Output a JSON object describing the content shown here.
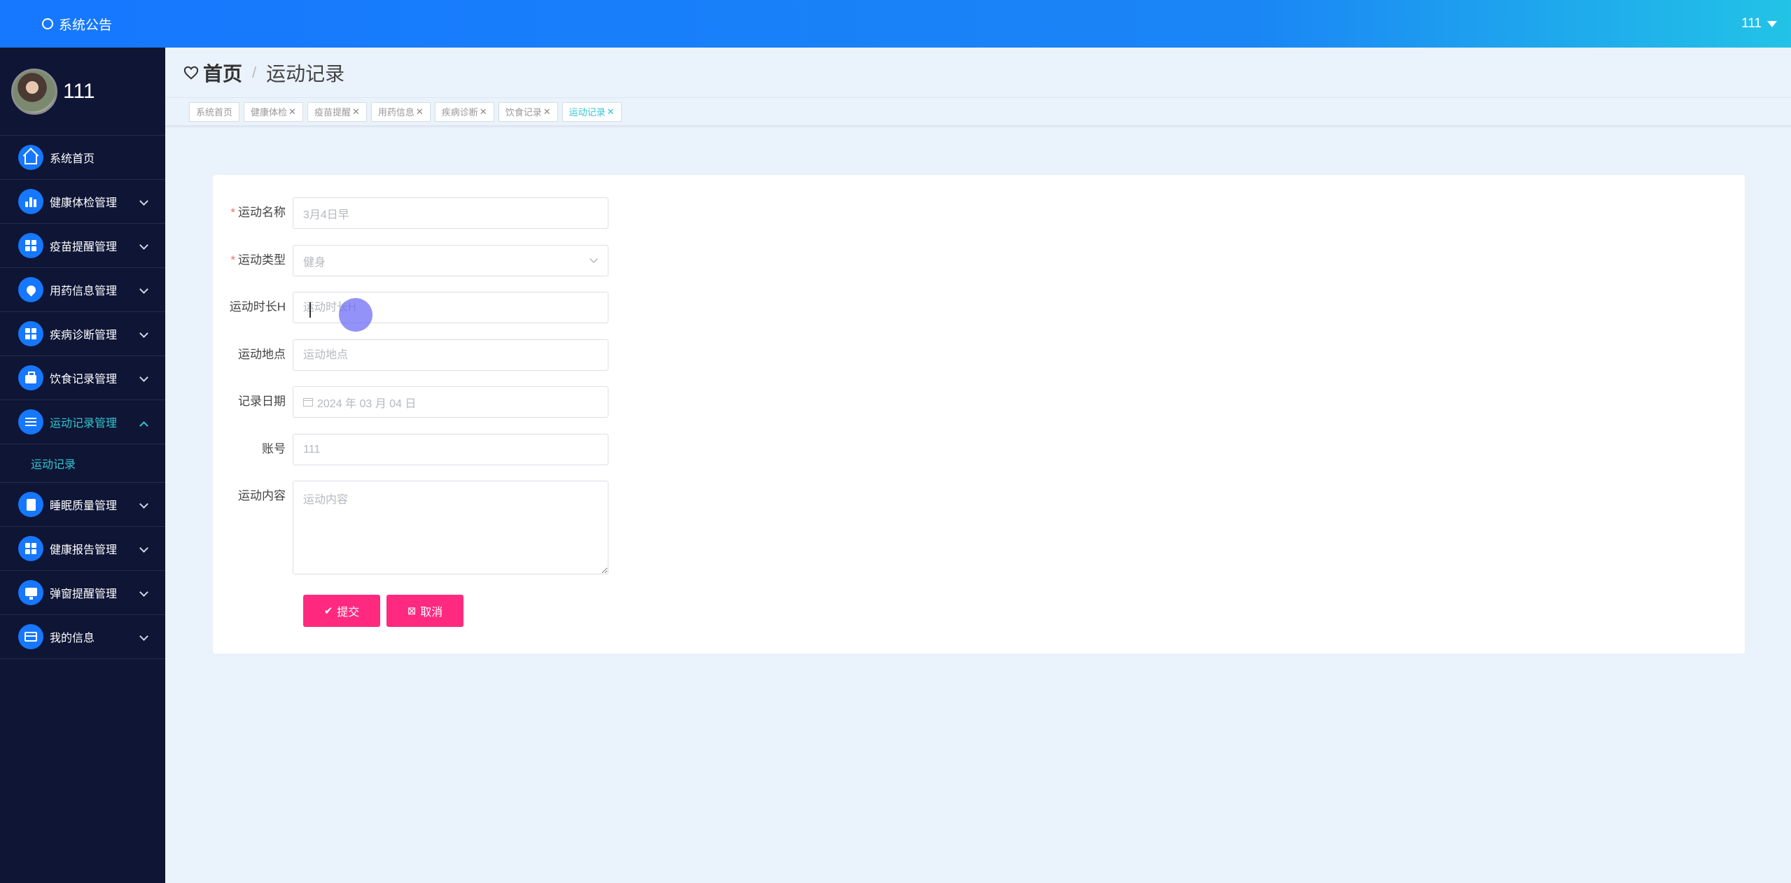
{
  "topbar": {
    "notice_label": "系统公告",
    "user_label": "111"
  },
  "profile": {
    "name": "111"
  },
  "sidebar": {
    "items": [
      {
        "label": "系统首页",
        "icon": "home-icon"
      },
      {
        "label": "健康体检管理",
        "icon": "bar-chart-icon"
      },
      {
        "label": "疫苗提醒管理",
        "icon": "grid-icon"
      },
      {
        "label": "用药信息管理",
        "icon": "location-icon"
      },
      {
        "label": "疾病诊断管理",
        "icon": "grid-icon"
      },
      {
        "label": "饮食记录管理",
        "icon": "briefcase-icon"
      },
      {
        "label": "运动记录管理",
        "icon": "list-icon"
      },
      {
        "label": "睡眠质量管理",
        "icon": "clipboard-icon"
      },
      {
        "label": "健康报告管理",
        "icon": "grid-icon"
      },
      {
        "label": "弹窗提醒管理",
        "icon": "monitor-icon"
      },
      {
        "label": "我的信息",
        "icon": "card-icon"
      }
    ],
    "submenu_label": "运动记录"
  },
  "breadcrumb": {
    "home": "首页",
    "separator": "/",
    "current": "运动记录"
  },
  "tabs": [
    {
      "label": "系统首页",
      "closable": false
    },
    {
      "label": "健康体检",
      "closable": true
    },
    {
      "label": "疫苗提醒",
      "closable": true
    },
    {
      "label": "用药信息",
      "closable": true
    },
    {
      "label": "疾病诊断",
      "closable": true
    },
    {
      "label": "饮食记录",
      "closable": true
    },
    {
      "label": "运动记录",
      "closable": true
    }
  ],
  "form": {
    "name_label": "运动名称",
    "name_value": "3月4日早",
    "type_label": "运动类型",
    "type_value": "健身",
    "duration_label": "运动时长H",
    "duration_placeholder": "运动时长H",
    "location_label": "运动地点",
    "location_placeholder": "运动地点",
    "date_label": "记录日期",
    "date_value": "2024 年 03 月 04 日",
    "account_label": "账号",
    "account_value": "111",
    "content_label": "运动内容",
    "content_placeholder": "运动内容",
    "submit_label": "提交",
    "cancel_label": "取消"
  },
  "colors": {
    "accent": "#1677ff",
    "active": "#31c6d0",
    "button": "#ff2a7f",
    "sidebar_bg": "#0f1535"
  }
}
